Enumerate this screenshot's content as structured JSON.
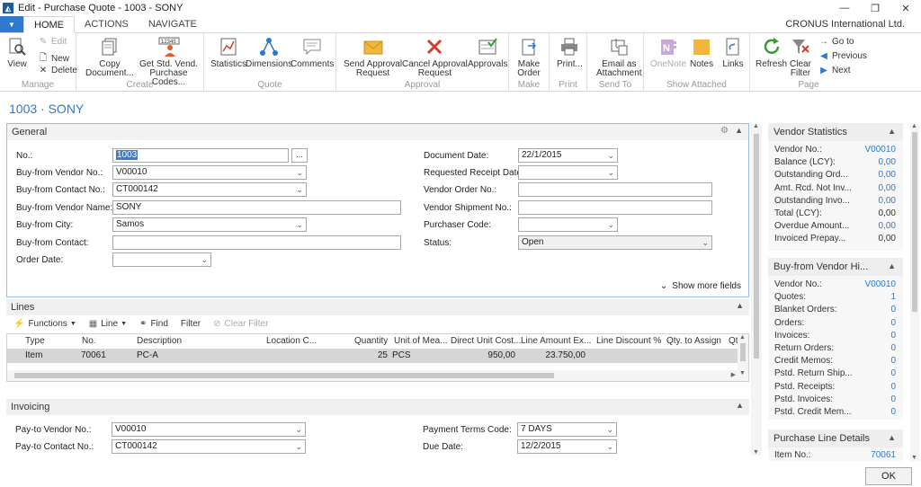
{
  "window": {
    "title": "Edit - Purchase Quote - 1003 - SONY",
    "app_icon": "nav-logo-icon"
  },
  "ribbon_tabs": [
    "HOME",
    "ACTIONS",
    "NAVIGATE"
  ],
  "company": "CRONUS International Ltd.",
  "ribbon": {
    "manage": {
      "label": "Manage",
      "view": "View",
      "edit": "Edit",
      "new": "New",
      "delete": "Delete"
    },
    "create": {
      "label": "Create",
      "copy_doc_1": "Copy",
      "copy_doc_2": "Document...",
      "get_std_1": "Get Std. Vend.",
      "get_std_2": "Purchase Codes..."
    },
    "quote": {
      "label": "Quote",
      "statistics": "Statistics",
      "dimensions": "Dimensions",
      "comments": "Comments"
    },
    "approval": {
      "label": "Approval",
      "send_1": "Send Approval",
      "send_2": "Request",
      "cancel_1": "Cancel Approval",
      "cancel_2": "Request",
      "approvals": "Approvals"
    },
    "make": {
      "label": "Make",
      "make_1": "Make",
      "make_2": "Order"
    },
    "print": {
      "label": "Print",
      "print": "Print..."
    },
    "send_to": {
      "label": "Send To",
      "email_1": "Email as",
      "email_2": "Attachment"
    },
    "show_attached": {
      "label": "Show Attached",
      "onenote": "OneNote",
      "notes": "Notes",
      "links": "Links"
    },
    "page": {
      "label": "Page",
      "refresh": "Refresh",
      "clear_1": "Clear",
      "clear_2": "Filter",
      "goto": "Go to",
      "previous": "Previous",
      "next": "Next"
    }
  },
  "page_title": "1003 · SONY",
  "general": {
    "header": "General",
    "left": [
      {
        "label": "No.:",
        "value": "1003"
      },
      {
        "label": "Buy-from Vendor No.:",
        "value": "V00010"
      },
      {
        "label": "Buy-from Contact No.:",
        "value": "CT000142"
      },
      {
        "label": "Buy-from Vendor Name:",
        "value": "SONY"
      },
      {
        "label": "Buy-from City:",
        "value": "Samos"
      },
      {
        "label": "Buy-from Contact:",
        "value": ""
      },
      {
        "label": "Order Date:",
        "value": ""
      }
    ],
    "right": [
      {
        "label": "Document Date:",
        "value": "22/1/2015"
      },
      {
        "label": "Requested Receipt Date:",
        "value": ""
      },
      {
        "label": "Vendor Order No.:",
        "value": ""
      },
      {
        "label": "Vendor Shipment No.:",
        "value": ""
      },
      {
        "label": "Purchaser Code:",
        "value": ""
      },
      {
        "label": "Status:",
        "value": "Open"
      }
    ],
    "show_more": "Show more fields"
  },
  "lines": {
    "header": "Lines",
    "toolbar": {
      "functions": "Functions",
      "line": "Line",
      "find": "Find",
      "filter": "Filter",
      "clear_filter": "Clear Filter"
    },
    "columns": [
      "Type",
      "No.",
      "Description",
      "Location C...",
      "Quantity",
      "Unit of Mea...",
      "Direct Unit Cost...",
      "Line Amount Ex...",
      "Line Discount %",
      "Qty. to Assign",
      "Qt"
    ],
    "rows": [
      {
        "type": "Item",
        "no": "70061",
        "description": "PC-A",
        "location": "",
        "quantity": "25",
        "uom": "PCS",
        "unit_cost": "950,00",
        "line_amount": "23.750,00",
        "discount": "",
        "qty_assign": ""
      }
    ]
  },
  "invoicing": {
    "header": "Invoicing",
    "left": [
      {
        "label": "Pay-to Vendor No.:",
        "value": "V00010"
      },
      {
        "label": "Pay-to Contact No.:",
        "value": "CT000142"
      }
    ],
    "right": [
      {
        "label": "Payment Terms Code:",
        "value": "7 DAYS"
      },
      {
        "label": "Due Date:",
        "value": "12/2/2015"
      }
    ]
  },
  "vendor_statistics": {
    "title": "Vendor Statistics",
    "rows": [
      {
        "label": "Vendor No.:",
        "value": "V00010",
        "link": true
      },
      {
        "label": "Balance (LCY):",
        "value": "0,00",
        "link": true
      },
      {
        "label": "Outstanding Ord...",
        "value": "0,00",
        "link": true
      },
      {
        "label": "Amt. Rcd. Not Inv...",
        "value": "0,00",
        "link": true
      },
      {
        "label": "Outstanding Invo...",
        "value": "0,00",
        "link": true
      },
      {
        "label": "Total (LCY):",
        "value": "0,00",
        "link": false
      },
      {
        "label": "Overdue Amount...",
        "value": "0,00",
        "link": true
      },
      {
        "label": "Invoiced Prepay...",
        "value": "0,00",
        "link": false
      }
    ]
  },
  "buy_from_history": {
    "title": "Buy-from Vendor Hi...",
    "rows": [
      {
        "label": "Vendor No.:",
        "value": "V00010"
      },
      {
        "label": "Quotes:",
        "value": "1"
      },
      {
        "label": "Blanket Orders:",
        "value": "0"
      },
      {
        "label": "Orders:",
        "value": "0"
      },
      {
        "label": "Invoices:",
        "value": "0"
      },
      {
        "label": "Return Orders:",
        "value": "0"
      },
      {
        "label": "Credit Memos:",
        "value": "0"
      },
      {
        "label": "Pstd. Return Ship...",
        "value": "0"
      },
      {
        "label": "Pstd. Receipts:",
        "value": "0"
      },
      {
        "label": "Pstd. Invoices:",
        "value": "0"
      },
      {
        "label": "Pstd. Credit Mem...",
        "value": "0"
      }
    ]
  },
  "purchase_line_details": {
    "title": "Purchase Line Details",
    "rows": [
      {
        "label": "Item No.:",
        "value": "70061"
      }
    ]
  },
  "ok_label": "OK",
  "colors": {
    "accent": "#2b79d1",
    "file_tab": "#2b79d1",
    "selected_row": "#d6d6d6"
  }
}
